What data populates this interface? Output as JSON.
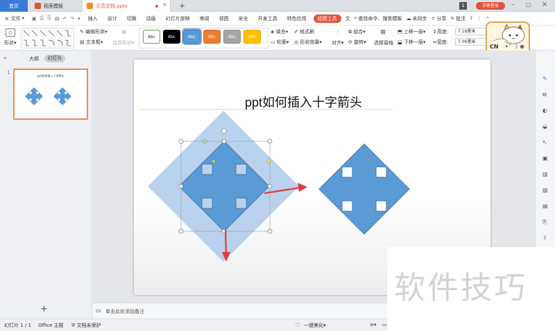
{
  "tabs": {
    "home": "首页",
    "template": "稻壳模板",
    "doc": "示范文档.pptx",
    "add": "+",
    "page_num": "1",
    "login": "访客登录"
  },
  "menu": {
    "file": "文件",
    "items": [
      "插入",
      "设计",
      "切换",
      "动画",
      "幻灯片放映",
      "审阅",
      "视图",
      "安全",
      "开发工具",
      "特色应用"
    ],
    "active": "绘图工具",
    "text_tool": "文",
    "search": "查找命令、搜索模板",
    "sync": "未同步",
    "share": "分享",
    "review": "批注",
    "help": "?"
  },
  "toolbar": {
    "shape": "形状",
    "edit_shape": "编辑形状",
    "textbox": "文本框",
    "merge_shape": "合并形状",
    "styles": [
      {
        "label": "Abc",
        "bg": "#ffffff",
        "fg": "#333333",
        "border": "#5aa64b"
      },
      {
        "label": "Abc",
        "bg": "#000000",
        "fg": "#ffffff",
        "border": "#000000"
      },
      {
        "label": "Abc",
        "bg": "#5b9bd5",
        "fg": "#ffffff",
        "border": "#3d7dbb"
      },
      {
        "label": "Abc",
        "bg": "#ed7d31",
        "fg": "#ffffff",
        "border": "#d16a26"
      },
      {
        "label": "Abc",
        "bg": "#a5a5a5",
        "fg": "#ffffff",
        "border": "#8b8b8b"
      },
      {
        "label": "Abc",
        "bg": "#ffc000",
        "fg": "#ffffff",
        "border": "#e0a800"
      }
    ],
    "fill": "填充",
    "format_brush": "格式刷",
    "outline": "轮廓",
    "shape_effect": "形状效果",
    "align": "对齐",
    "group": "组合",
    "rotate": "旋转",
    "selection_pane": "选择窗格",
    "bring_forward": "上移一层",
    "send_backward": "下移一层",
    "height_label": "高度:",
    "height": "7.18厘米",
    "width_label": "宽度:",
    "width": "7.06厘米"
  },
  "sticker": {
    "text": "CN"
  },
  "left": {
    "outline_tab": "大纲",
    "slides_tab": "幻灯片",
    "slide_number": "1",
    "thumb_title": "ppt如何插入十字箭头",
    "add": "+"
  },
  "slide": {
    "title": "ppt如何插入十字箭头"
  },
  "notes": {
    "placeholder": "单击此处添加备注"
  },
  "status": {
    "slide_count": "幻灯片 1 / 1",
    "theme": "Office 主题",
    "protect": "文档未保护",
    "beautify": "一键美化"
  },
  "watermark": "软件技巧",
  "colors": {
    "accent": "#e0533b",
    "arrow": "#5b9bd5",
    "arrow_dark": "#3f76b0",
    "arrow_light": "#a9c7e8",
    "red_arrow": "#e03a3a"
  }
}
